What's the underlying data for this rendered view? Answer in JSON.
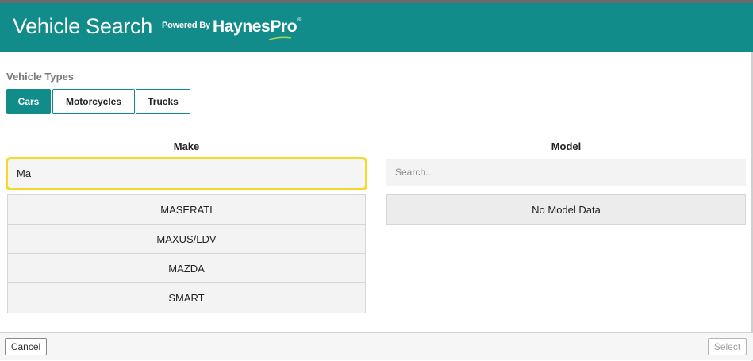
{
  "header": {
    "title": "Vehicle Search",
    "powered_by": "Powered By",
    "brand_main": "Haynes",
    "brand_pro": "Pro",
    "brand_reg": "®"
  },
  "vehicle_types": {
    "label": "Vehicle Types",
    "options": [
      {
        "label": "Cars",
        "active": true
      },
      {
        "label": "Motorcycles",
        "active": false
      },
      {
        "label": "Trucks",
        "active": false
      }
    ]
  },
  "make": {
    "heading": "Make",
    "input_value": "Ma",
    "results": [
      "MASERATI",
      "MAXUS/LDV",
      "MAZDA",
      "SMART"
    ]
  },
  "model": {
    "heading": "Model",
    "placeholder": "Search...",
    "empty_message": "No Model Data"
  },
  "footer": {
    "cancel_label": "Cancel",
    "select_label": "Select"
  },
  "colors": {
    "brand_teal": "#128c8a",
    "highlight_yellow": "#f2dc29"
  }
}
